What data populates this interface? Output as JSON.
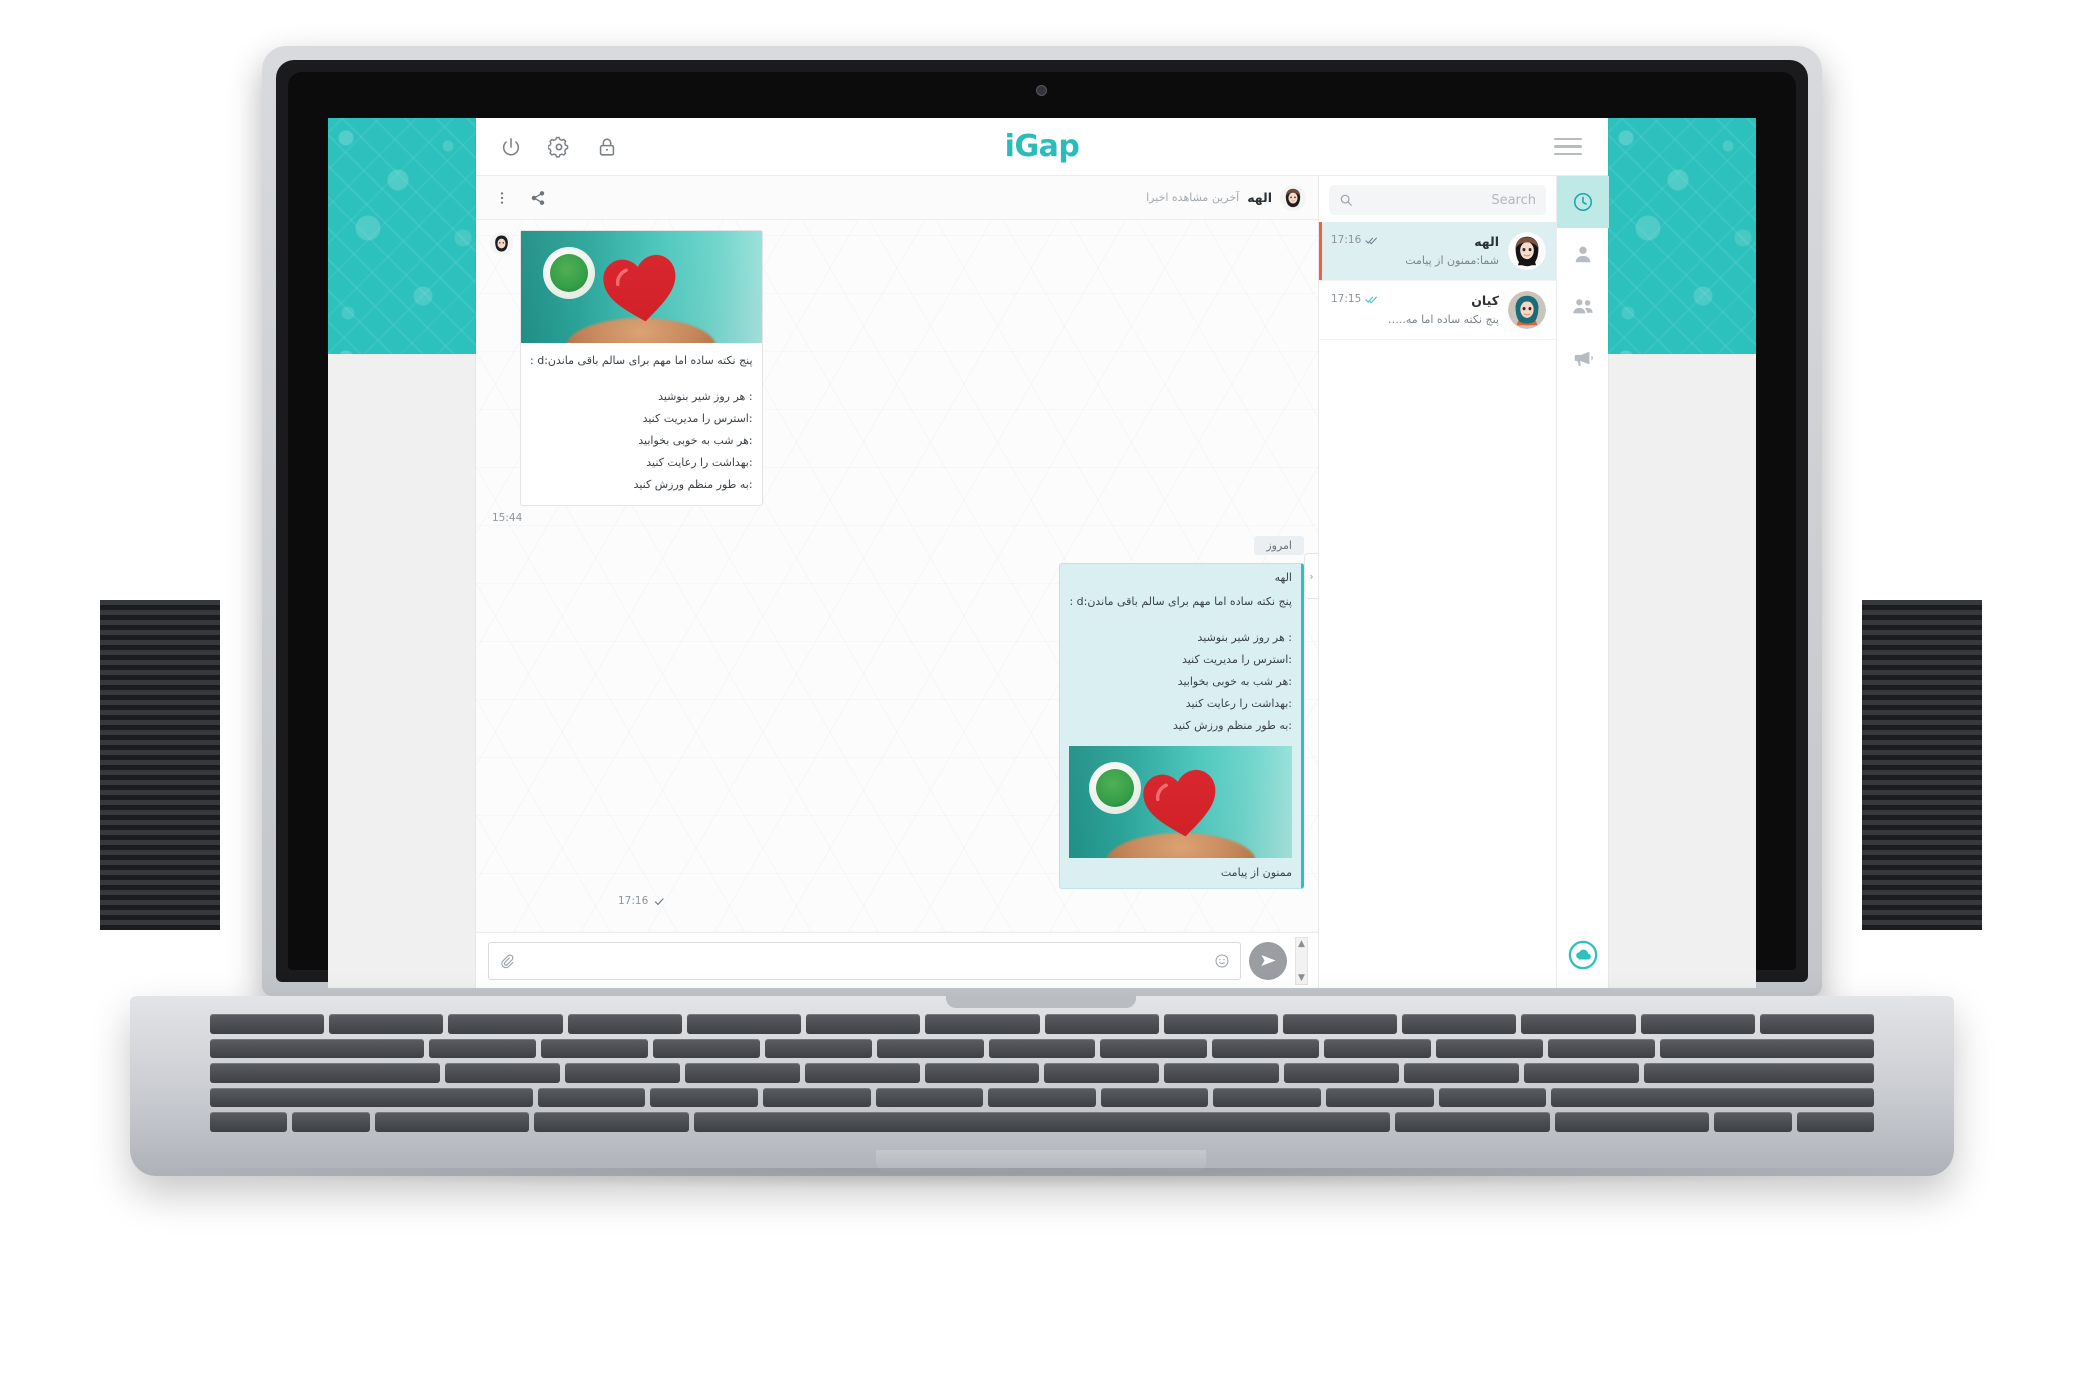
{
  "app": {
    "logo": "iGap",
    "topbar": {
      "power_icon": "power-icon",
      "settings_icon": "gear-icon",
      "lock_icon": "lock-icon",
      "menu_icon": "hamburger-icon"
    }
  },
  "search": {
    "placeholder": "Search",
    "value": ""
  },
  "chat_list": [
    {
      "name": "الهه",
      "snippet": "شما:ممنون از پیامت",
      "time": "17:16",
      "tick": "double-check",
      "tick_color": "#6d7c88",
      "selected": true
    },
    {
      "name": "کیان",
      "snippet": "پنج نکته ساده اما مه...:d",
      "time": "17:15",
      "tick": "double-check",
      "tick_color": "#2dc1bd",
      "selected": false
    }
  ],
  "rail": {
    "items": [
      {
        "icon": "clock-icon",
        "active": true
      },
      {
        "icon": "person-icon",
        "active": false
      },
      {
        "icon": "group-icon",
        "active": false
      },
      {
        "icon": "megaphone-icon",
        "active": false
      }
    ],
    "cloud_icon": "cloud-icon"
  },
  "conversation": {
    "header": {
      "title": "الهه",
      "subtitle": "آخرین مشاهده اخیرا",
      "more_icon": "more-vertical-icon",
      "share_icon": "share-icon"
    },
    "side_toggle": "›",
    "day_divider": "امروز",
    "messages": [
      {
        "direction": "in",
        "has_photo": true,
        "lead": "پنج نکته ساده اما مهم برای سالم باقی ماندن:d :",
        "lines": [
          ": هر روز شیر بنوشید",
          ":استرس را مدیریت کنید",
          ":هر شب به خوبی بخوابید",
          ":بهداشت را رعایت کنید",
          ":به طور منظم ورزش کنید"
        ],
        "time": "15:44"
      },
      {
        "direction": "out",
        "sender": "الهه",
        "has_photo": true,
        "lead": "پنج نکته ساده اما مهم برای سالم باقی ماندن:d :",
        "lines": [
          ": هر روز شیر بنوشید",
          ":استرس را مدیریت کنید",
          ":هر شب به خوبی بخوابید",
          ":بهداشت را رعایت کنید",
          ":به طور منظم ورزش کنید"
        ],
        "tail_text": "ممنون از پیامت",
        "time": "17:16",
        "tick": "single-check"
      }
    ]
  },
  "composer": {
    "attach_icon": "paperclip-icon",
    "emoji_icon": "emoji-icon",
    "send_icon": "send-icon",
    "placeholder": "",
    "value": ""
  },
  "colors": {
    "brand_teal": "#2dc1bd",
    "selected_chat": "#ddeff0",
    "out_bubble": "#d9eff1",
    "unread_marker": "#ef6144"
  }
}
